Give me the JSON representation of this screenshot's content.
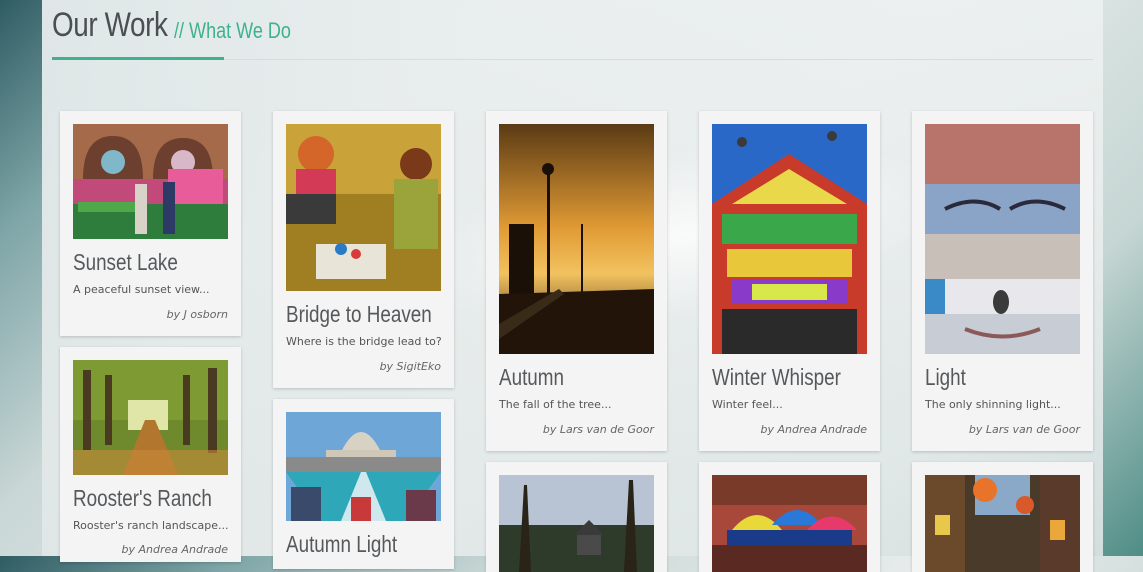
{
  "header": {
    "title": "Our Work",
    "subtitle": "// What We Do"
  },
  "colors": {
    "accent": "#3fb18c",
    "title": "#4b4f52"
  },
  "cards": [
    {
      "title": "Sunset Lake",
      "description": "A peaceful sunset view...",
      "author": "by J osborn"
    },
    {
      "title": "Rooster's Ranch",
      "description": "Rooster's ranch landscape...",
      "author": "by Andrea Andrade"
    },
    {
      "title": "Bridge to Heaven",
      "description": "Where is the bridge lead to?",
      "author": "by SigitEko"
    },
    {
      "title": "Autumn Light",
      "description": "",
      "author": ""
    },
    {
      "title": "Autumn",
      "description": "The fall of the tree...",
      "author": "by Lars van de Goor"
    },
    {
      "title": "",
      "description": "",
      "author": ""
    },
    {
      "title": "Winter Whisper",
      "description": "Winter feel...",
      "author": "by Andrea Andrade"
    },
    {
      "title": "",
      "description": "",
      "author": ""
    },
    {
      "title": "Light",
      "description": "The only shinning light...",
      "author": "by Lars van de Goor"
    },
    {
      "title": "",
      "description": "",
      "author": ""
    }
  ]
}
